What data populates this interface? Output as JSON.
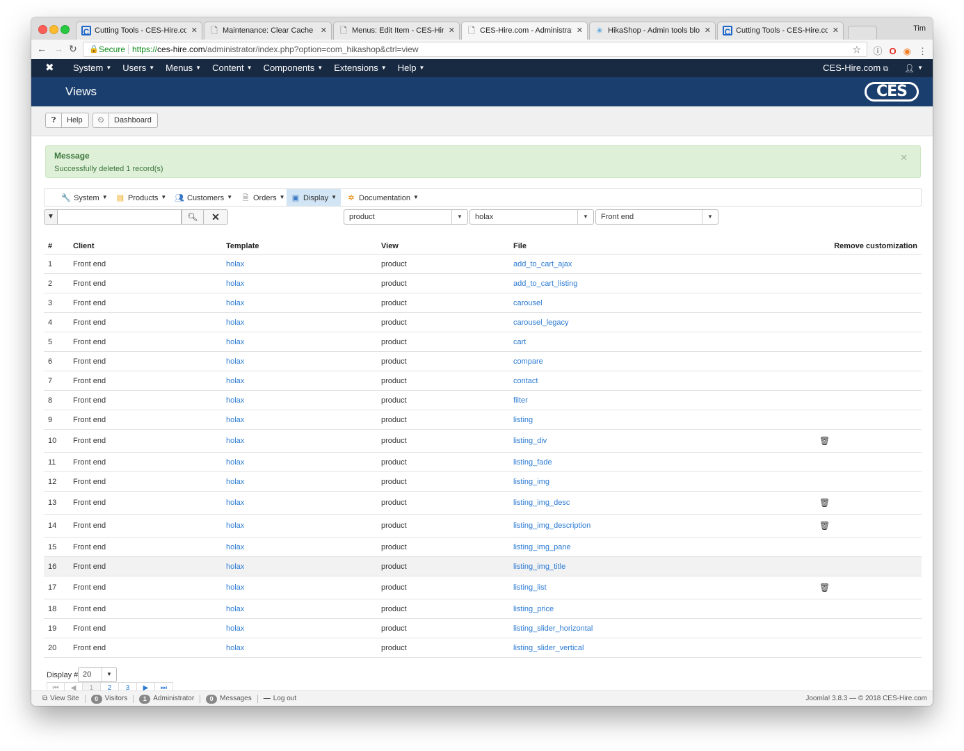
{
  "browser": {
    "tabs": [
      {
        "title": "Cutting Tools - CES-Hire.com",
        "icon": "ces-favicon"
      },
      {
        "title": "Maintenance: Clear Cache (Sit",
        "icon": "document-icon"
      },
      {
        "title": "Menus: Edit Item - CES-Hire.c",
        "icon": "document-icon"
      },
      {
        "title": "CES-Hire.com - Administration",
        "icon": "document-icon",
        "active": true
      },
      {
        "title": "HikaShop - Admin tools blocks",
        "icon": "hikashop-favicon"
      },
      {
        "title": "Cutting Tools - CES-Hire.com",
        "icon": "ces-favicon"
      }
    ],
    "profile": "Tim",
    "secure_label": "Secure",
    "url_scheme": "https://",
    "url_host": "ces-hire.com",
    "url_path": "/administrator/index.php?option=com_hikashop&ctrl=view"
  },
  "navbar": {
    "menu": [
      "System",
      "Users",
      "Menus",
      "Content",
      "Components",
      "Extensions",
      "Help"
    ],
    "site": "CES-Hire.com"
  },
  "header": {
    "title": "Views",
    "logo": "CES"
  },
  "toolbar": {
    "help": "Help",
    "dashboard": "Dashboard"
  },
  "alert": {
    "heading": "Message",
    "text": "Successfully deleted 1 record(s)"
  },
  "submenu": {
    "items": [
      {
        "label": "System",
        "icon": "wrench-icon"
      },
      {
        "label": "Products",
        "icon": "products-icon"
      },
      {
        "label": "Customers",
        "icon": "customers-icon"
      },
      {
        "label": "Orders",
        "icon": "orders-icon"
      },
      {
        "label": "Display",
        "icon": "display-icon",
        "active": true
      },
      {
        "label": "Documentation",
        "icon": "documentation-icon"
      }
    ]
  },
  "filters": {
    "search_value": "",
    "view": "product",
    "template": "holax",
    "client": "Front end"
  },
  "table": {
    "headers": {
      "num": "#",
      "client": "Client",
      "template": "Template",
      "view": "View",
      "file": "File",
      "remove": "Remove customization"
    },
    "rows": [
      {
        "num": "1",
        "client": "Front end",
        "template": "holax",
        "view": "product",
        "file": "add_to_cart_ajax",
        "trash": false
      },
      {
        "num": "2",
        "client": "Front end",
        "template": "holax",
        "view": "product",
        "file": "add_to_cart_listing",
        "trash": false
      },
      {
        "num": "3",
        "client": "Front end",
        "template": "holax",
        "view": "product",
        "file": "carousel",
        "trash": false
      },
      {
        "num": "4",
        "client": "Front end",
        "template": "holax",
        "view": "product",
        "file": "carousel_legacy",
        "trash": false
      },
      {
        "num": "5",
        "client": "Front end",
        "template": "holax",
        "view": "product",
        "file": "cart",
        "trash": false
      },
      {
        "num": "6",
        "client": "Front end",
        "template": "holax",
        "view": "product",
        "file": "compare",
        "trash": false
      },
      {
        "num": "7",
        "client": "Front end",
        "template": "holax",
        "view": "product",
        "file": "contact",
        "trash": false
      },
      {
        "num": "8",
        "client": "Front end",
        "template": "holax",
        "view": "product",
        "file": "filter",
        "trash": false
      },
      {
        "num": "9",
        "client": "Front end",
        "template": "holax",
        "view": "product",
        "file": "listing",
        "trash": false
      },
      {
        "num": "10",
        "client": "Front end",
        "template": "holax",
        "view": "product",
        "file": "listing_div",
        "trash": true
      },
      {
        "num": "11",
        "client": "Front end",
        "template": "holax",
        "view": "product",
        "file": "listing_fade",
        "trash": false
      },
      {
        "num": "12",
        "client": "Front end",
        "template": "holax",
        "view": "product",
        "file": "listing_img",
        "trash": false
      },
      {
        "num": "13",
        "client": "Front end",
        "template": "holax",
        "view": "product",
        "file": "listing_img_desc",
        "trash": true
      },
      {
        "num": "14",
        "client": "Front end",
        "template": "holax",
        "view": "product",
        "file": "listing_img_description",
        "trash": true
      },
      {
        "num": "15",
        "client": "Front end",
        "template": "holax",
        "view": "product",
        "file": "listing_img_pane",
        "trash": false
      },
      {
        "num": "16",
        "client": "Front end",
        "template": "holax",
        "view": "product",
        "file": "listing_img_title",
        "trash": false,
        "hover": true
      },
      {
        "num": "17",
        "client": "Front end",
        "template": "holax",
        "view": "product",
        "file": "listing_list",
        "trash": true
      },
      {
        "num": "18",
        "client": "Front end",
        "template": "holax",
        "view": "product",
        "file": "listing_price",
        "trash": false
      },
      {
        "num": "19",
        "client": "Front end",
        "template": "holax",
        "view": "product",
        "file": "listing_slider_horizontal",
        "trash": false
      },
      {
        "num": "20",
        "client": "Front end",
        "template": "holax",
        "view": "product",
        "file": "listing_slider_vertical",
        "trash": false
      }
    ]
  },
  "pagination": {
    "display_label": "Display #",
    "display_value": "20",
    "pages": [
      "1",
      "2",
      "3"
    ],
    "current": "1"
  },
  "statusbar": {
    "view_site": "View Site",
    "visitors_count": "0",
    "visitors": "Visitors",
    "admin_count": "1",
    "admin": "Administrator",
    "messages_count": "0",
    "messages": "Messages",
    "logout": "Log out",
    "version": "Joomla! 3.8.3  —  © 2018 CES-Hire.com"
  }
}
